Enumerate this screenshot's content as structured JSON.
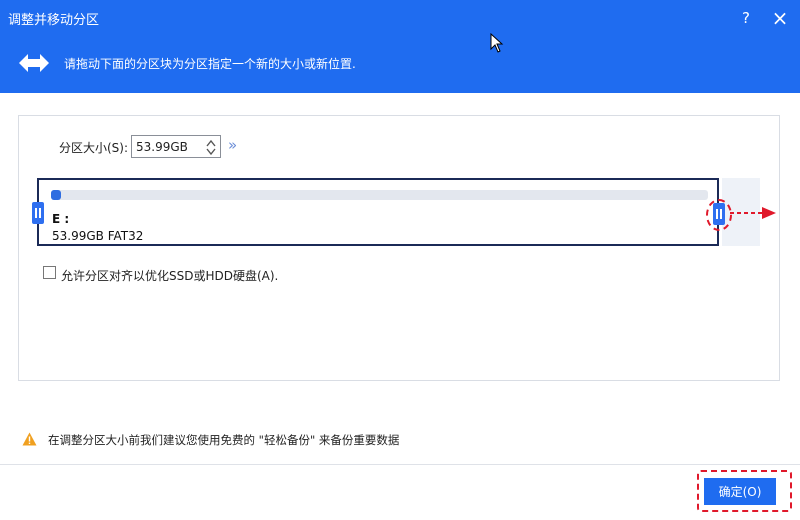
{
  "window": {
    "title": "调整并移动分区",
    "help_label": "?",
    "close_label": "×"
  },
  "banner": {
    "icon": "left-right-arrow-icon",
    "text": "请拖动下面的分区块为分区指定一个新的大小或新位置."
  },
  "size": {
    "label": "分区大小(S):",
    "value": "53.99GB"
  },
  "partition": {
    "letter": "E :",
    "info": "53.99GB FAT32",
    "usage_fraction": 0.015
  },
  "align": {
    "label": "允许分区对齐以优化SSD或HDD硬盘(A).",
    "checked": false
  },
  "warning": {
    "icon": "warning-icon",
    "text": "在调整分区大小前我们建议您使用免费的 \"轻松备份\" 来备份重要数据"
  },
  "buttons": {
    "ok": "确定(O)"
  },
  "colors": {
    "accent": "#1f6cf0",
    "highlight": "#e0192b",
    "partition_border": "#1b2a57",
    "handle": "#2e6ff0"
  }
}
